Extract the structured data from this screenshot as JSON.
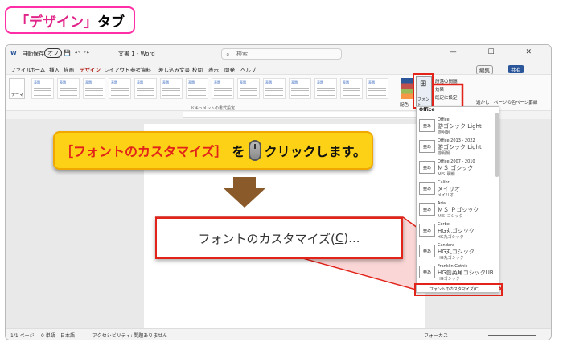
{
  "banner": {
    "open": "「",
    "title": "デザイン",
    "close": "」",
    "suffix": "タブ"
  },
  "window": {
    "autosave_label": "自動保存",
    "autosave_state": "オフ",
    "doc_title": "文書 1 - Word",
    "search_placeholder": "検索",
    "controls": "— ☐ ✕"
  },
  "menu": [
    "ファイル",
    "ホーム",
    "挿入",
    "描画",
    "デザイン",
    "レイアウト",
    "参考資料",
    "差し込み文書",
    "校閲",
    "表示",
    "開発",
    "ヘルプ"
  ],
  "ribbon": {
    "theme_label": "テーマ",
    "doc_format_label": "ドキュメントの書式設定",
    "thumb_label": "表題",
    "colors_label": "配色",
    "fonts_label": "フォント",
    "spacing_label": "段落の間隔",
    "effects_label": "効果",
    "default_label": "既定に設定",
    "watermark_label": "透かし",
    "page_color_label": "ページの色",
    "page_border_label": "ページ罫線",
    "edit_label": "編集",
    "share_label": "共有"
  },
  "font_panel": {
    "header": "Office",
    "items": [
      {
        "name": "Office",
        "line1": "游ゴシック Light",
        "line2": "游明朝",
        "icon": "亜あ"
      },
      {
        "name": "Office 2013 - 2022",
        "line1": "游ゴシック Light",
        "line2": "游明朝",
        "icon": "亜あ"
      },
      {
        "name": "Office 2007 - 2010",
        "line1": "ＭＳ ゴシック",
        "line2": "ＭＳ 明朝",
        "icon": "亜あ"
      },
      {
        "name": "Calibri",
        "line1": "メイリオ",
        "line2": "メイリオ",
        "icon": "亜あ"
      },
      {
        "name": "Arial",
        "line1": "ＭＳ Ｐゴシック",
        "line2": "ＭＳ ゴシック",
        "icon": "亜あ"
      },
      {
        "name": "Corbel",
        "line1": "HG丸ゴシック",
        "line2": "HG丸ゴシック",
        "icon": "亜あ"
      },
      {
        "name": "Candara",
        "line1": "HG丸ゴシック",
        "line2": "HG丸ゴシック",
        "icon": "亜あ"
      },
      {
        "name": "Franklin Gothic",
        "line1": "HG創英角ゴシックUB",
        "line2": "HGゴシック",
        "icon": "亜あ"
      }
    ],
    "customize": "フォントのカスタマイズ(C)..."
  },
  "callout": {
    "part1": "［フォントのカスタマイズ］",
    "part2": "を",
    "part3": "クリックします。"
  },
  "zoom": {
    "text": "フォントのカスタマイズ(",
    "key": "C",
    "tail": ")..."
  },
  "status": {
    "pages": "1/1 ページ",
    "words": "0 単語",
    "lang": "日本語",
    "accessibility": "アクセシビリティ: 問題ありません",
    "focus": "フォーカス"
  },
  "colors": {
    "accent": "#b0221a",
    "callout": "#fcd116",
    "highlight": "#e2231a",
    "banner_border": "#ff2ea6"
  }
}
